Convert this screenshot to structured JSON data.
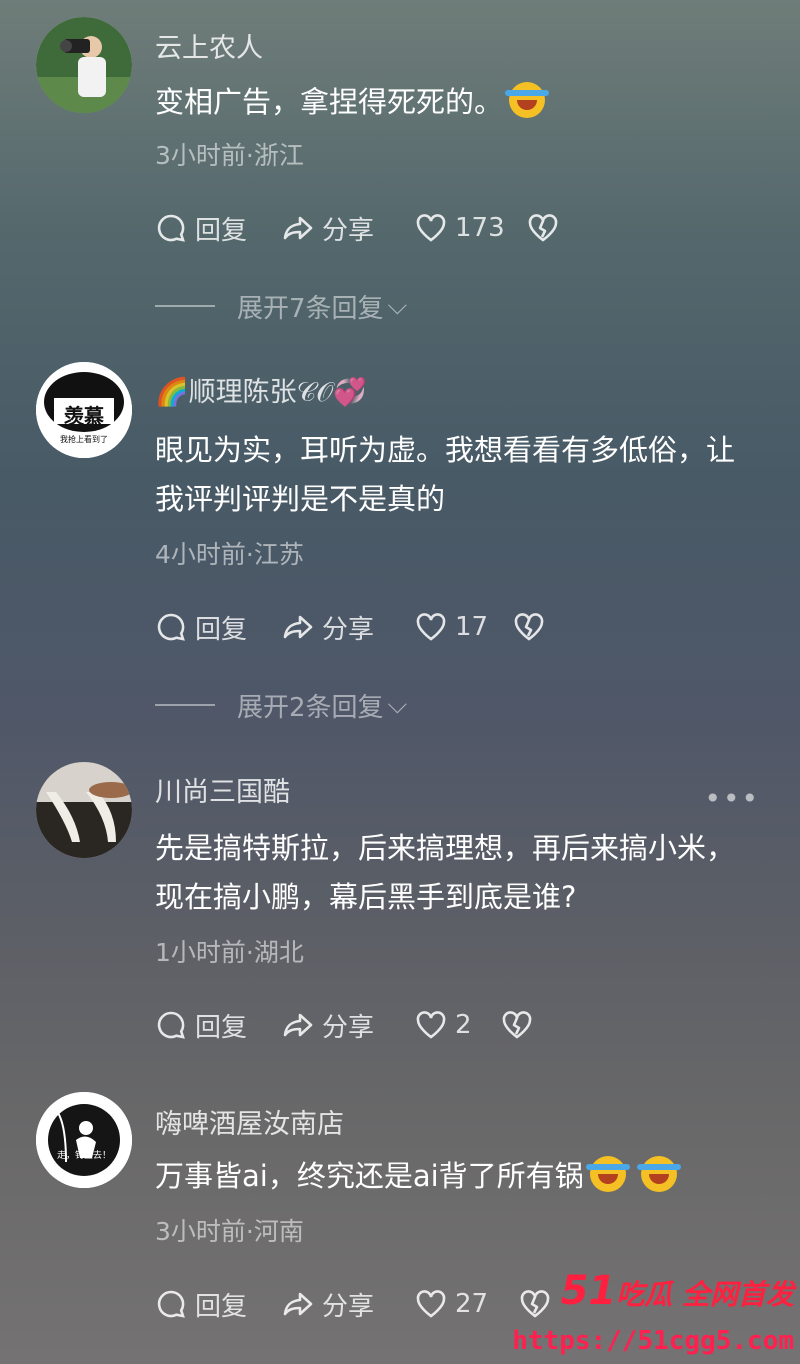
{
  "comments": [
    {
      "name": "云上农人",
      "text": "变相广告，拿捏得死死的。",
      "meta": "3小时前·浙江",
      "reply_label": "回复",
      "share_label": "分享",
      "likes": "173",
      "expand_text": "展开7条回复"
    },
    {
      "name": "🌈顺理陈张",
      "name_suffix": "𝒞𝒪💞",
      "text": "眼见为实，耳听为虚。我想看看有多低俗，让我评判评判是不是真的",
      "meta": "4小时前·江苏",
      "reply_label": "回复",
      "share_label": "分享",
      "likes": "17",
      "expand_text": "展开2条回复",
      "avatar_text": "羡慕",
      "avatar_subtext": "我抢上看到了"
    },
    {
      "name": "川尚三国酷",
      "text": "先是搞特斯拉，后来搞理想，再后来搞小米，现在搞小鹏，幕后黑手到底是谁?",
      "meta": "1小时前·湖北",
      "reply_label": "回复",
      "share_label": "分享",
      "likes": "2",
      "more": "•••"
    },
    {
      "name": "嗨啤酒屋汝南店",
      "text": "万事皆ai，终究还是ai背了所有锅",
      "meta": "3小时前·河南",
      "reply_label": "回复",
      "share_label": "分享",
      "likes": "27",
      "avatar_text": "走，钓鱼去！"
    }
  ],
  "watermark": {
    "brand_number": "51",
    "brand_text": "吃瓜 全网首发",
    "url": "https://51cgg5.com"
  },
  "icons": [
    "comment-bubble-icon",
    "share-arrow-icon",
    "heart-icon",
    "broken-heart-icon",
    "laugh-cry-emoji"
  ],
  "colors": {
    "watermark": "#ff2040",
    "emoji": "#f5c023"
  }
}
